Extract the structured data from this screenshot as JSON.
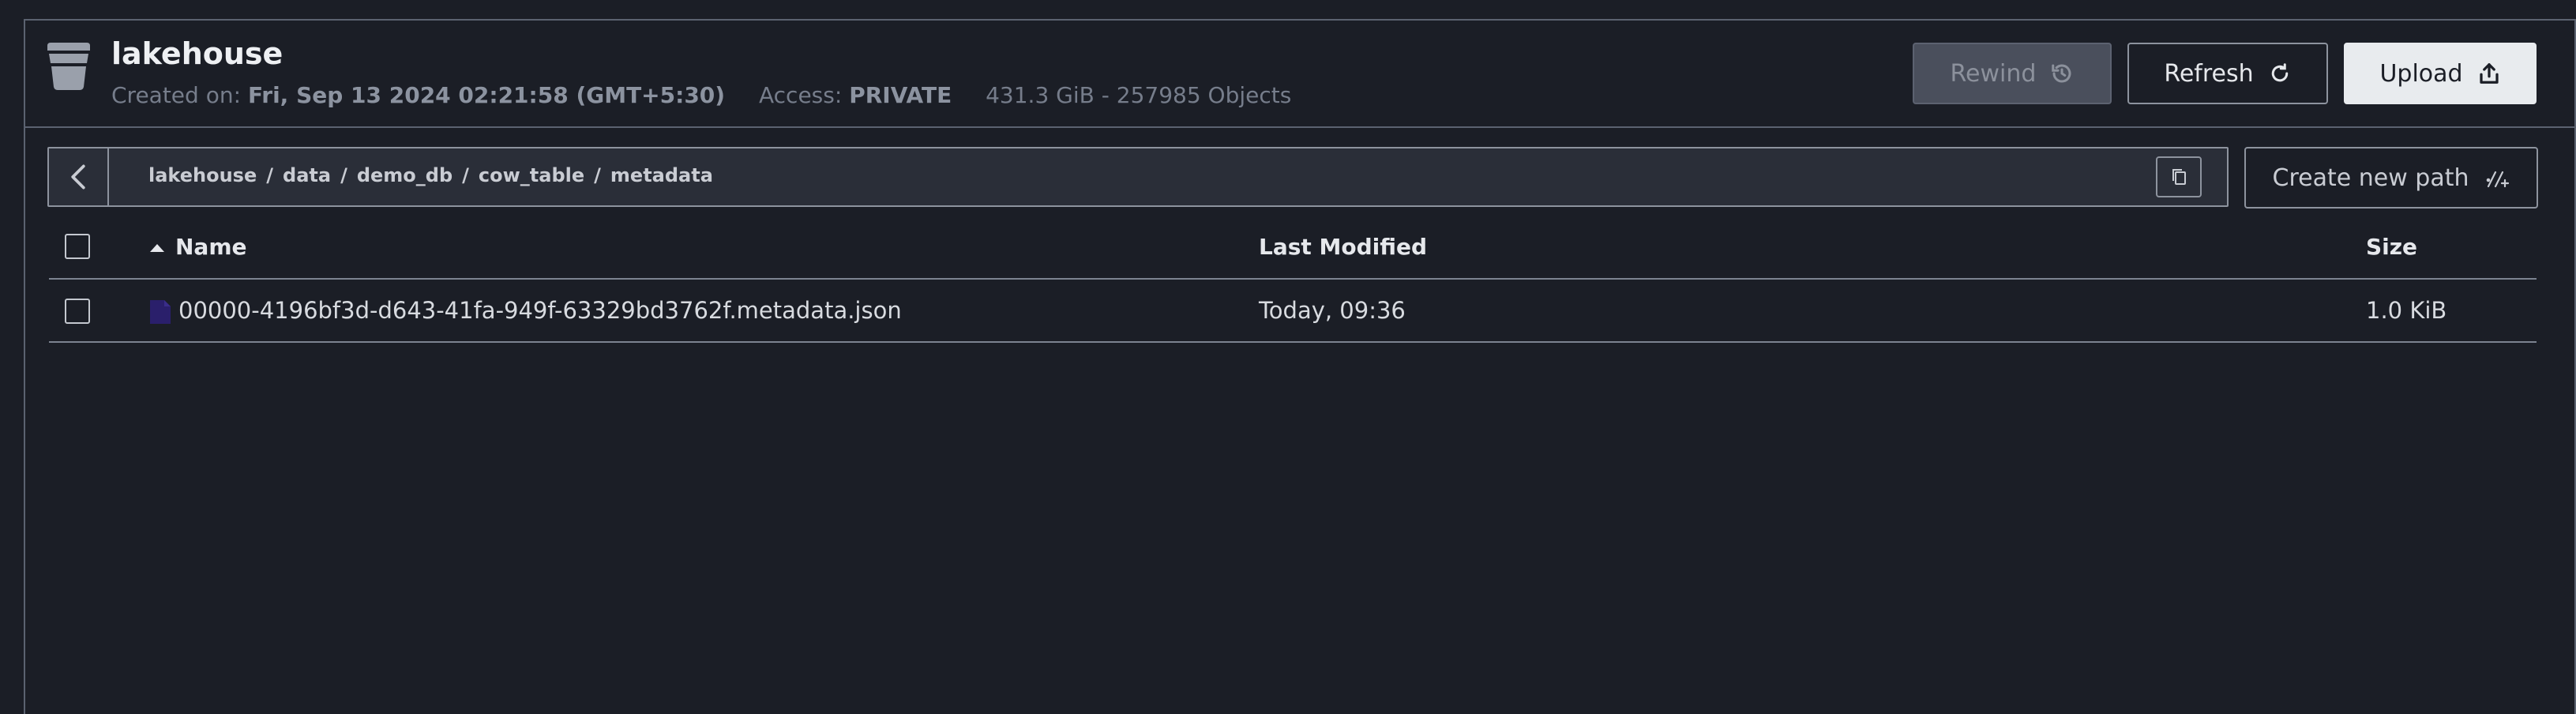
{
  "bucket": {
    "name": "lakehouse",
    "created_label": "Created on:",
    "created_value": "Fri, Sep 13 2024 02:21:58 (GMT+5:30)",
    "access_label": "Access:",
    "access_value": "PRIVATE",
    "usage": "431.3 GiB - 257985 Objects"
  },
  "toolbar": {
    "rewind_label": "Rewind",
    "refresh_label": "Refresh",
    "upload_label": "Upload"
  },
  "path": {
    "crumbs": [
      "lakehouse",
      "data",
      "demo_db",
      "cow_table",
      "metadata"
    ],
    "separator": "/",
    "create_new_path_label": "Create new path"
  },
  "table": {
    "headers": {
      "name": "Name",
      "last_modified": "Last Modified",
      "size": "Size"
    },
    "rows": [
      {
        "name": "00000-4196bf3d-d643-41fa-949f-63329bd3762f.metadata.json",
        "last_modified": "Today, 09:36",
        "size": "1.0 KiB"
      }
    ]
  },
  "icons": {
    "bucket": "bucket-icon",
    "rewind": "history-icon",
    "refresh": "refresh-icon",
    "upload": "upload-icon",
    "back": "chevron-left-icon",
    "copy": "copy-icon",
    "new_path": "new-path-icon",
    "sort": "sort-up-icon",
    "file": "file-icon"
  },
  "colors": {
    "background": "#1b1e26",
    "upload_button": "#e8ebee",
    "file_icon": "#2a1f6b"
  }
}
